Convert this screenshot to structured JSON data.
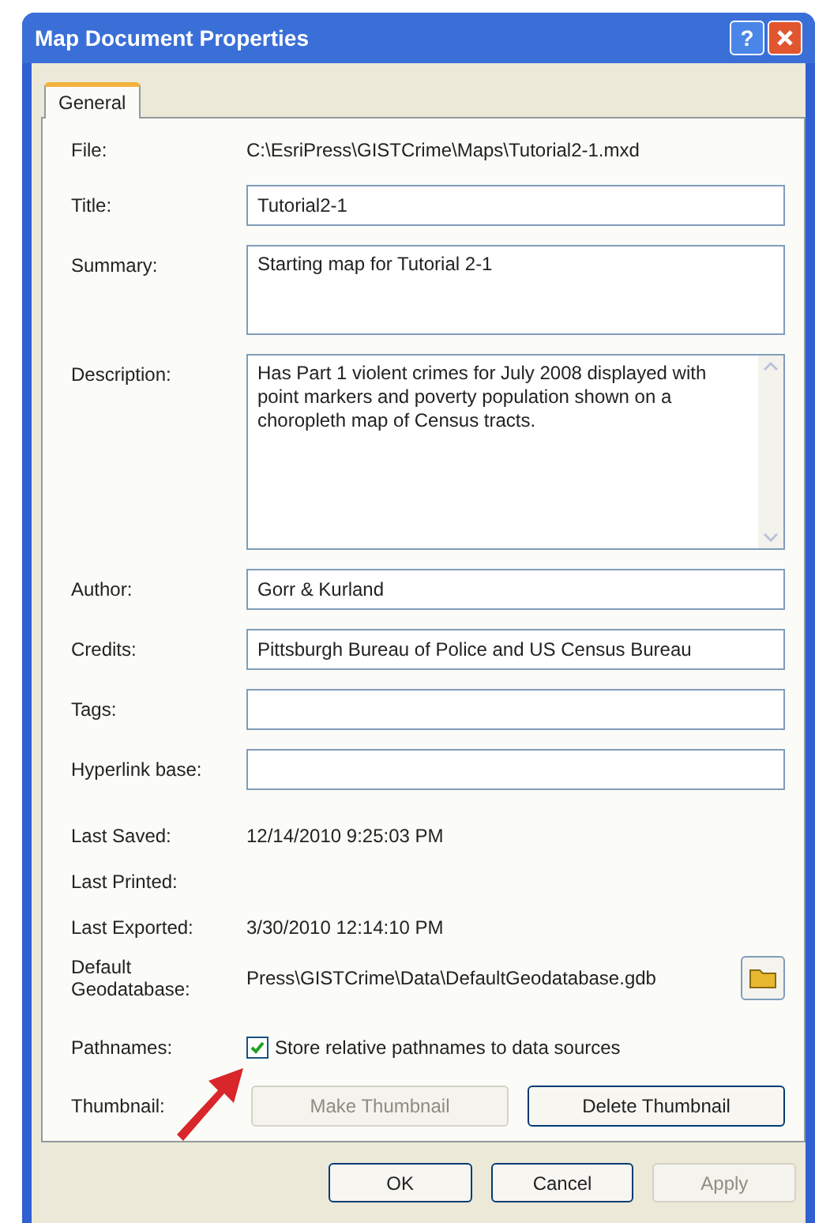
{
  "window": {
    "title": "Map Document Properties",
    "help_button": "?"
  },
  "tabs": [
    {
      "label": "General",
      "selected": true
    }
  ],
  "fields": [
    {
      "kind": "text",
      "label": "File:",
      "value": "C:\\EsriPress\\GISTCrime\\Maps\\Tutorial2-1.mxd"
    },
    {
      "kind": "input",
      "label": "Title:",
      "value": "Tutorial2-1"
    },
    {
      "kind": "area",
      "label": "Summary:",
      "value": "Starting map for Tutorial 2-1"
    },
    {
      "kind": "scrollarea",
      "label": "Description:",
      "value": "Has Part 1 violent crimes for July 2008 displayed with point markers and poverty population shown on a choropleth map of Census tracts."
    },
    {
      "kind": "input",
      "label": "Author:",
      "value": "Gorr & Kurland"
    },
    {
      "kind": "input",
      "label": "Credits:",
      "value": "Pittsburgh Bureau of Police and US Census Bureau"
    },
    {
      "kind": "input",
      "label": "Tags:"
    },
    {
      "kind": "input",
      "label": "Hyperlink base:"
    },
    {
      "kind": "text",
      "label": "Last Saved:",
      "value": "12/14/2010 9:25:03 PM"
    },
    {
      "kind": "text",
      "label": "Last Printed:"
    },
    {
      "kind": "text",
      "label": "Last Exported:",
      "value": "3/30/2010 12:14:10 PM"
    },
    {
      "kind": "path",
      "label": "Default Geodatabase:",
      "value": "Press\\GISTCrime\\Data\\DefaultGeodatabase.gdb"
    },
    {
      "kind": "checkbox",
      "label": "Pathnames:",
      "text": "Store relative pathnames to data sources",
      "checked": true
    },
    {
      "kind": "buttons",
      "label": "Thumbnail:",
      "buttons": [
        {
          "label": "Make Thumbnail",
          "disabled": true
        },
        {
          "label": "Delete Thumbnail",
          "disabled": false
        }
      ]
    }
  ],
  "buttons": [
    {
      "label": "OK",
      "disabled": false
    },
    {
      "label": "Cancel",
      "disabled": false
    },
    {
      "label": "Apply",
      "disabled": true
    }
  ]
}
